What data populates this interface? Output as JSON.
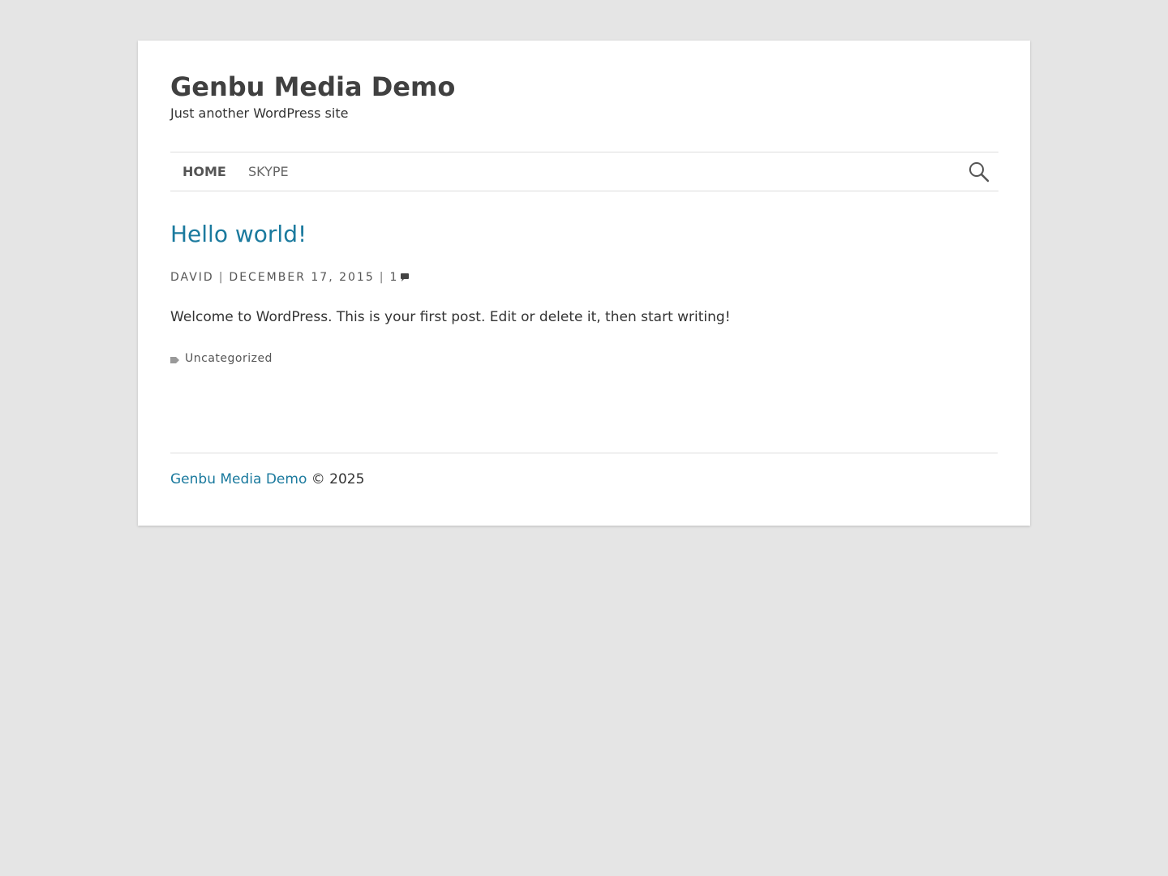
{
  "site": {
    "title": "Genbu Media Demo",
    "description": "Just another WordPress site"
  },
  "nav": {
    "items": [
      {
        "label": "HOME",
        "active": true
      },
      {
        "label": "SKYPE",
        "active": false
      }
    ],
    "search_icon": "search-icon"
  },
  "post": {
    "title": "Hello world!",
    "author": "DAVID",
    "date": "DECEMBER 17, 2015",
    "separator": "|",
    "comment_count": "1",
    "comment_icon": "comment-icon",
    "body": "Welcome to WordPress. This is your first post. Edit or delete it, then start writing!",
    "category": "Uncategorized",
    "category_icon": "tag-icon"
  },
  "footer": {
    "site_link": "Genbu Media Demo",
    "copyright": "© 2025"
  },
  "colors": {
    "background": "#e5e5e5",
    "page": "#ffffff",
    "link": "#1b7a9e",
    "title": "#404040"
  }
}
